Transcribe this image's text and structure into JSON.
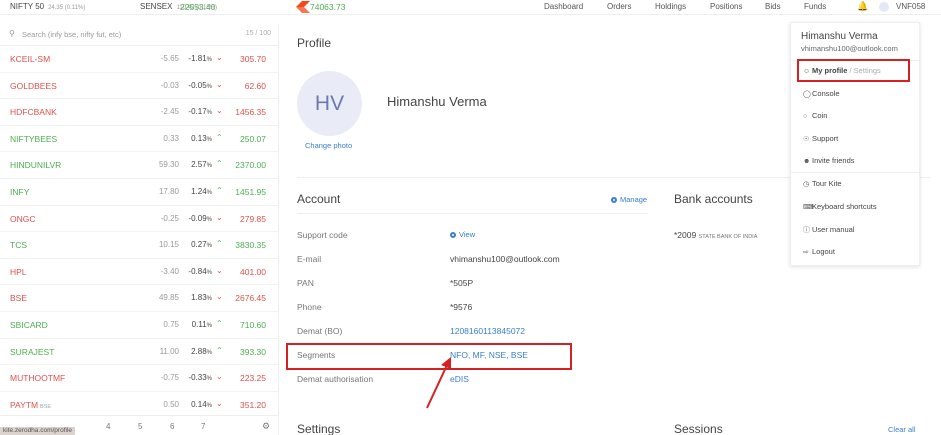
{
  "topbar": {
    "indices": [
      {
        "name": "NIFTY 50",
        "value": "22553.40",
        "change": "24.35 (0.11%)"
      },
      {
        "name": "SENSEX",
        "value": "74063.73",
        "change": "110.42 (0.15%)"
      }
    ],
    "nav": [
      "Dashboard",
      "Orders",
      "Holdings",
      "Positions",
      "Bids",
      "Funds"
    ],
    "user_id": "VNF058",
    "accent": "#f6461a"
  },
  "watchlist": {
    "search_placeholder": "Search (infy bse, nifty fut, etc)",
    "count": "15 / 100",
    "rows": [
      {
        "symbol": "KCEIL-SM",
        "change": "-5.65",
        "pct": "-1.81",
        "price": "305.70",
        "dir": "down"
      },
      {
        "symbol": "GOLDBEES",
        "change": "-0.03",
        "pct": "-0.05",
        "price": "62.60",
        "dir": "down"
      },
      {
        "symbol": "HDFCBANK",
        "change": "-2.45",
        "pct": "-0.17",
        "price": "1456.35",
        "dir": "down"
      },
      {
        "symbol": "NIFTYBEES",
        "change": "0.33",
        "pct": "0.13",
        "price": "250.07",
        "dir": "up"
      },
      {
        "symbol": "HINDUNILVR",
        "change": "59.30",
        "pct": "2.57",
        "price": "2370.00",
        "dir": "up"
      },
      {
        "symbol": "INFY",
        "change": "17.80",
        "pct": "1.24",
        "price": "1451.95",
        "dir": "up"
      },
      {
        "symbol": "ONGC",
        "change": "-0.25",
        "pct": "-0.09",
        "price": "279.85",
        "dir": "down"
      },
      {
        "symbol": "TCS",
        "change": "10.15",
        "pct": "0.27",
        "price": "3830.35",
        "dir": "up"
      },
      {
        "symbol": "HPL",
        "change": "-3.40",
        "pct": "-0.84",
        "price": "401.00",
        "dir": "down"
      },
      {
        "symbol": "BSE",
        "change": "49.85",
        "pct": "1.83",
        "price": "2676.45",
        "dir": "down"
      },
      {
        "symbol": "SBICARD",
        "change": "0.75",
        "pct": "0.11",
        "price": "710.60",
        "dir": "up"
      },
      {
        "symbol": "SURAJEST",
        "change": "11.00",
        "pct": "2.88",
        "price": "393.30",
        "dir": "up"
      },
      {
        "symbol": "MUTHOOTMF",
        "change": "-0.75",
        "pct": "-0.33",
        "price": "223.25",
        "dir": "down"
      },
      {
        "symbol": "PAYTM",
        "badge": "BSE",
        "change": "0.50",
        "pct": "0.14",
        "price": "351.20",
        "dir": "down"
      }
    ],
    "pct_suffix": "%",
    "pages": [
      "4",
      "5",
      "6",
      "7"
    ],
    "status_url": "kite.zerodha.com/profile"
  },
  "profile": {
    "title": "Profile",
    "initials": "HV",
    "change_photo": "Change photo",
    "name": "Himanshu Verma"
  },
  "account": {
    "title": "Account",
    "manage": "Manage",
    "view": "View",
    "labels": {
      "support_code": "Support code",
      "email": "E-mail",
      "pan": "PAN",
      "phone": "Phone",
      "demat": "Demat (BO)",
      "segments": "Segments",
      "demat_auth": "Demat authorisation"
    },
    "values": {
      "email": "vhimanshu100@outlook.com",
      "pan": "*505P",
      "phone": "*9576",
      "demat": "1208160113845072",
      "segments": "NFO, MF, NSE, BSE",
      "demat_auth": "eDIS"
    }
  },
  "bank": {
    "title": "Bank accounts",
    "account": "*2009",
    "bank_name": "STATE BANK OF INDIA"
  },
  "settings": {
    "title": "Settings"
  },
  "sessions": {
    "title": "Sessions",
    "clear_all": "Clear all"
  },
  "dropdown": {
    "name": "Himanshu Verma",
    "email": "vhimanshu100@outlook.com",
    "my_profile": "My profile",
    "settings": "/ Settings",
    "items": [
      "Console",
      "Coin",
      "Support",
      "Invite friends"
    ],
    "items2": [
      "Tour Kite",
      "Keyboard shortcuts",
      "User manual",
      "Logout"
    ]
  },
  "icons": {
    "search": "search-icon",
    "bell": "bell-icon",
    "gear": "gear-icon"
  }
}
